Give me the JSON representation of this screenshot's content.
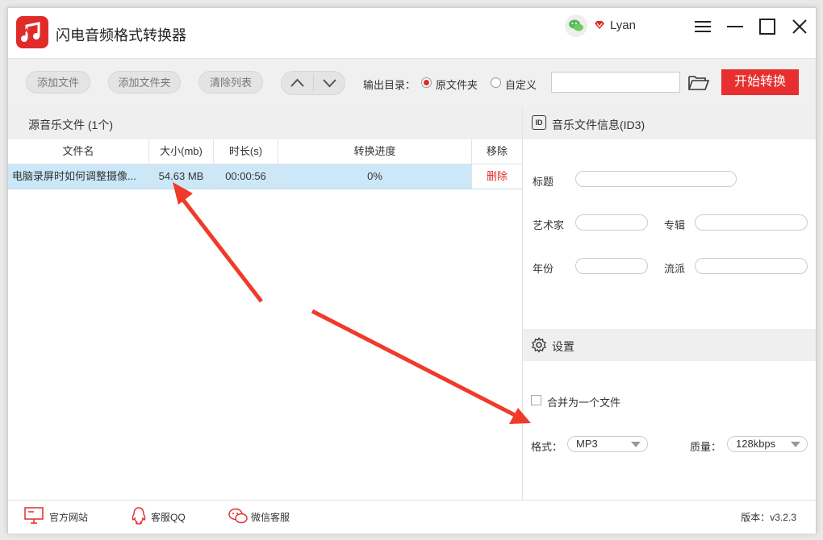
{
  "app": {
    "title": "闪电音频格式转换器",
    "user": "Lyan",
    "brand_color": "#e02b2b"
  },
  "toolbar": {
    "add_file": "添加文件",
    "add_folder": "添加文件夹",
    "clear_list": "清除列表",
    "output_label": "输出目录：",
    "radio_original": "原文件夹",
    "radio_custom": "自定义",
    "output_path_value": "",
    "start_convert": "开始转换"
  },
  "file_list": {
    "header": "源音乐文件 (1个)",
    "columns": [
      "文件名",
      "大小(mb)",
      "时长(s)",
      "转换进度",
      "移除"
    ],
    "rows": [
      {
        "name": "电脑录屏时如何调整摄像...",
        "size": "54.63 MB",
        "duration": "00:00:56",
        "progress": "0%",
        "remove": "删除"
      }
    ]
  },
  "id3": {
    "header": "音乐文件信息(ID3)",
    "title_label": "标题",
    "artist_label": "艺术家",
    "album_label": "专辑",
    "year_label": "年份",
    "genre_label": "流派"
  },
  "settings": {
    "header": "设置",
    "merge_label": "合并为一个文件",
    "format_label": "格式：",
    "format_value": "MP3",
    "quality_label": "质量：",
    "quality_value": "128kbps"
  },
  "footer": {
    "website": "官方网站",
    "qq": "客服QQ",
    "wechat": "微信客服",
    "version": "版本：v3.2.3"
  }
}
